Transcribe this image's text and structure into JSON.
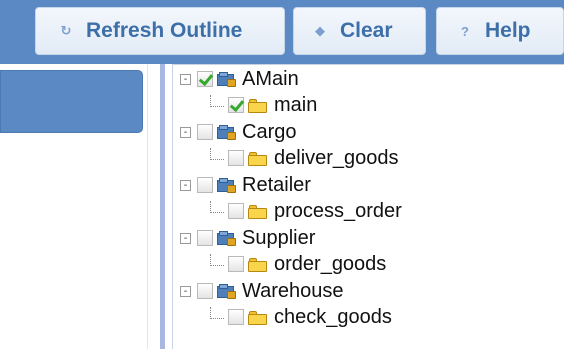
{
  "toolbar": {
    "refresh_label": "Refresh Outline",
    "clear_label": "Clear",
    "help_label": "Help"
  },
  "tree": {
    "nodes": [
      {
        "label": "AMain",
        "checked": true,
        "children": [
          {
            "label": "main",
            "checked": true
          }
        ]
      },
      {
        "label": "Cargo",
        "checked": false,
        "children": [
          {
            "label": "deliver_goods",
            "checked": false
          }
        ]
      },
      {
        "label": "Retailer",
        "checked": false,
        "children": [
          {
            "label": "process_order",
            "checked": false
          }
        ]
      },
      {
        "label": "Supplier",
        "checked": false,
        "children": [
          {
            "label": "order_goods",
            "checked": false
          }
        ]
      },
      {
        "label": "Warehouse",
        "checked": false,
        "children": [
          {
            "label": "check_goods",
            "checked": false
          }
        ]
      }
    ]
  },
  "colors": {
    "toolbar_bg": "#5b89c4",
    "button_text": "#3d6fa9",
    "check_green": "#35a82d",
    "splitter": "#a9b8e3"
  },
  "icons": {
    "refresh": "refresh-icon",
    "clear": "eraser-icon",
    "help": "question-icon",
    "package": "package-icon",
    "folder": "folder-icon"
  }
}
